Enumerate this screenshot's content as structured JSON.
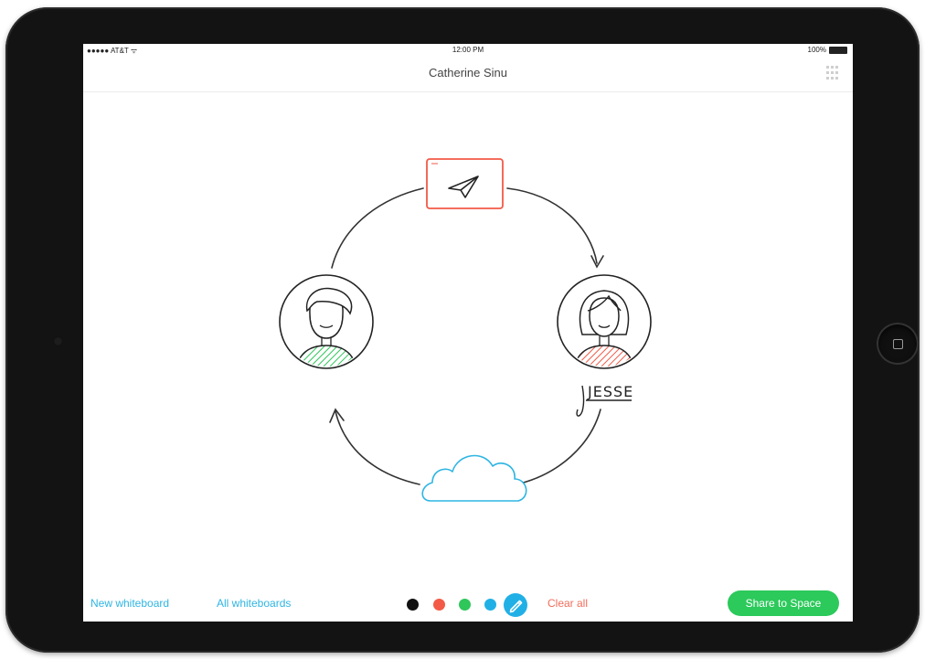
{
  "status_bar": {
    "carrier": "●●●●● AT&T ᯤ",
    "time": "12:00 PM",
    "battery": "100%"
  },
  "nav": {
    "title": "Catherine Sinu"
  },
  "whiteboard": {
    "label_jesse": "JESSE"
  },
  "toolbar": {
    "new_whiteboard": "New whiteboard",
    "all_whiteboards": "All whiteboards",
    "clear_all": "Clear all",
    "share": "Share to Space"
  },
  "colors": {
    "black": "#111111",
    "red": "#f25a47",
    "green": "#2fc65a",
    "blue": "#21b0e6",
    "share_green": "#2cc95b",
    "link_blue": "#2fb5e3"
  },
  "icons": [
    "paper-plane-icon",
    "grid-icon",
    "pen-icon",
    "cloud-icon",
    "avatar-man-icon",
    "avatar-woman-icon"
  ]
}
